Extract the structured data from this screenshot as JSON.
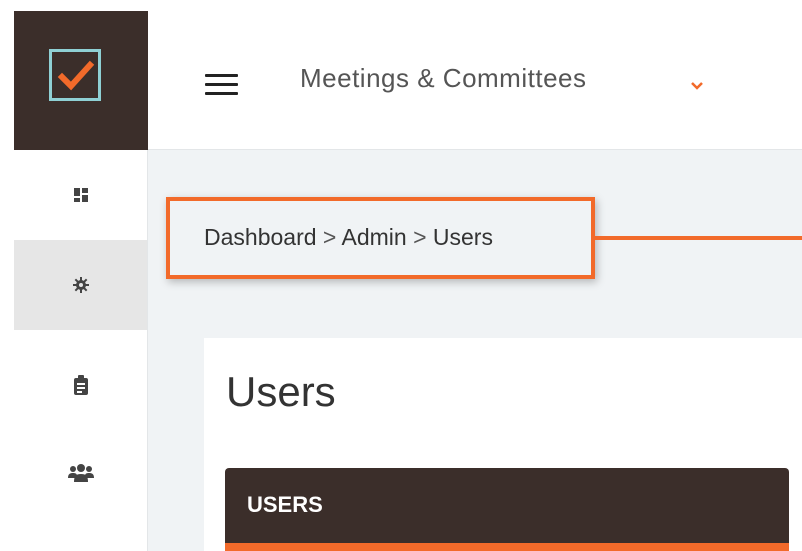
{
  "header": {
    "app_title": "Meetings & Committees",
    "logo_icon": "checkmark-logo-icon",
    "menu_icon": "hamburger-menu-icon",
    "caret_icon": "chevron-down-icon"
  },
  "sidebar": {
    "items": [
      {
        "icon": "dashboard-icon",
        "active": false
      },
      {
        "icon": "gear-icon",
        "active": true
      },
      {
        "icon": "clipboard-icon",
        "active": false
      },
      {
        "icon": "users-group-icon",
        "active": false
      }
    ]
  },
  "breadcrumb": {
    "items": [
      "Dashboard",
      "Admin",
      "Users"
    ],
    "separator": ">"
  },
  "main": {
    "page_title": "Users",
    "card_title": "USERS"
  },
  "colors": {
    "accent": "#f26a2a",
    "dark": "#3b2e2a",
    "logo_border": "#8fd0d4",
    "content_bg": "#f0f3f5"
  }
}
